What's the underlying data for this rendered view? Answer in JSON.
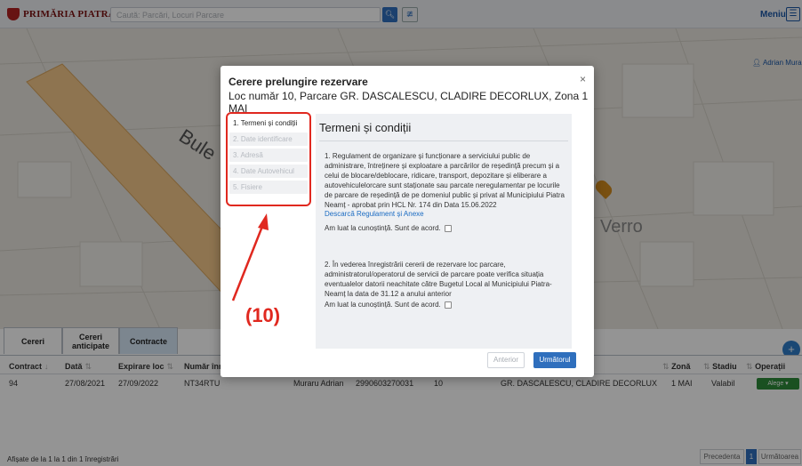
{
  "header": {
    "logo_text": "PRIMĂRIA PIATRA NEAMȚ",
    "search_placeholder": "Caută: Parcări, Locuri Parcare",
    "menu_label": "Meniu",
    "user_name": "Adrian Mura"
  },
  "map": {
    "street_label": "Bule",
    "place_label": "Verro"
  },
  "bottom_tabs": [
    {
      "label": "Cereri"
    },
    {
      "label": "Cereri anticipate"
    },
    {
      "label": "Contracte"
    }
  ],
  "table": {
    "headers": {
      "contract": "Contract",
      "data": "Dată",
      "expirare": "Expirare loc",
      "numar": "Număr înm",
      "zona": "Zonă",
      "stadiu": "Stadiu",
      "operatii": "Operații"
    },
    "row": {
      "contract": "94",
      "data": "27/08/2021",
      "expirare": "27/09/2022",
      "numar": "NT34RTU",
      "nume": "Muraru Adrian",
      "cnp": "2990603270031",
      "loc": "10",
      "parcare": "GR. DASCALESCU, CLADIRE DECORLUX",
      "zona": "1 MAI",
      "stadiu": "Valabil",
      "actiune": "Alege ▾"
    },
    "footer_info": "Afișate de la 1 la 1 din 1 înregistrări",
    "pagination": {
      "prev": "Precedenta",
      "page": "1",
      "next": "Următoarea"
    }
  },
  "modal": {
    "title": "Cerere prelungire rezervare",
    "subtitle": "Loc număr 10, Parcare GR. DASCALESCU, CLADIRE DECORLUX, Zona 1 MAI",
    "close": "×",
    "steps": [
      {
        "label": "1. Termeni și condiții",
        "active": true
      },
      {
        "label": "2. Date identificare",
        "active": false
      },
      {
        "label": "3. Adresă",
        "active": false
      },
      {
        "label": "4. Date Autovehicul",
        "active": false
      },
      {
        "label": "5. Fisiere",
        "active": false
      }
    ],
    "content_title": "Termeni și condiții",
    "paragraph_1": "1. Regulament de organizare și funcționare a serviciului public de administrare, întreținere și exploatare a parcărilor de reședință precum și a celui de blocare/deblocare, ridicare, transport, depozitare și eliberare a autovehiculelorcare sunt staționate sau parcate neregulamentar pe locurile de parcare de reședință de pe domeniul public și privat al Municipiului Piatra Neamț - aprobat prin HCL Nr. 174 din Data 15.06.2022",
    "link_1": "Descarcă Regulament și Anexe",
    "agree_1": "Am luat la cunoștință. Sunt de acord.",
    "paragraph_2": "2. În vederea înregistrării cererii de rezervare loc parcare, administratorul/operatorul de servicii de parcare poate verifica situația eventualelor datorii neachitate către Bugetul Local al Municipiului Piatra-Neamț la data de 31.12 a anului anterior",
    "agree_2": "Am luat la cunoștință. Sunt de acord.",
    "btn_prev": "Anterior",
    "btn_next": "Următorul"
  },
  "annotation": {
    "label": "(10)",
    "color": "#e0281f"
  }
}
